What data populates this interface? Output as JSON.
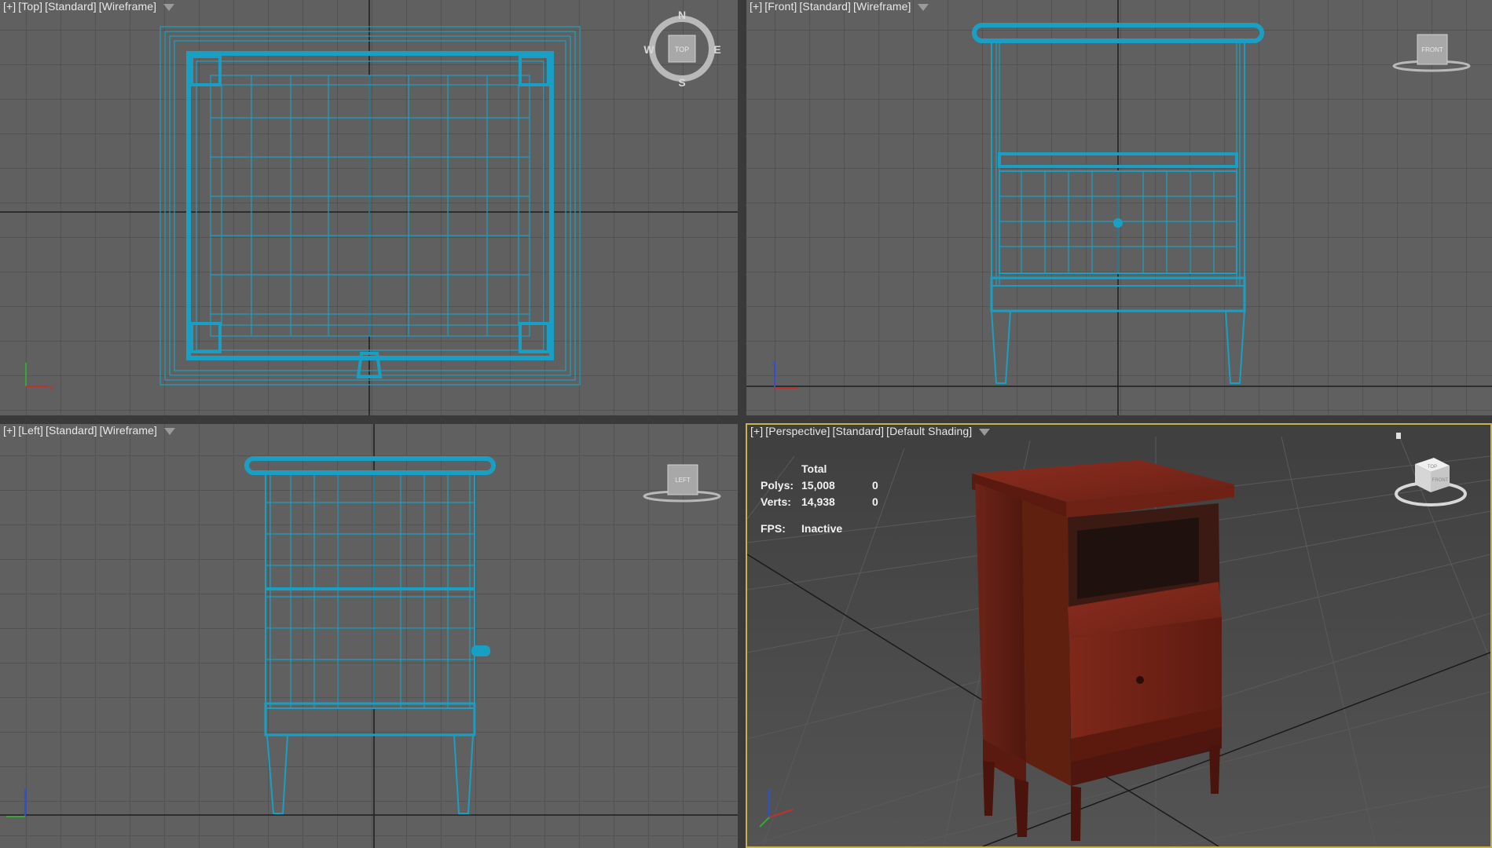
{
  "viewports": {
    "top": {
      "labels": [
        "[+]",
        "[Top]",
        "[Standard]",
        "[Wireframe]"
      ],
      "nav": {
        "cube_label": "TOP",
        "compass": {
          "n": "N",
          "s": "S",
          "e": "E",
          "w": "W"
        }
      }
    },
    "front": {
      "labels": [
        "[+]",
        "[Front]",
        "[Standard]",
        "[Wireframe]"
      ],
      "nav": {
        "cube_label": "FRONT"
      }
    },
    "left": {
      "labels": [
        "[+]",
        "[Left]",
        "[Standard]",
        "[Wireframe]"
      ],
      "nav": {
        "cube_label": "LEFT"
      }
    },
    "perspective": {
      "labels": [
        "[+]",
        "[Perspective]",
        "[Standard]",
        "[Default Shading]"
      ],
      "nav": {
        "cube_top": "TOP",
        "cube_front": "FRONT"
      },
      "stats": {
        "header": "Total",
        "polys_label": "Polys:",
        "polys_total": "15,008",
        "polys_selected": "0",
        "verts_label": "Verts:",
        "verts_total": "14,938",
        "verts_selected": "0",
        "fps_label": "FPS:",
        "fps_value": "Inactive"
      }
    }
  },
  "axes": {
    "x": "x",
    "y": "y",
    "z": "z"
  },
  "colors": {
    "wireframe": "#1a9fc4",
    "selection_border": "#c8b24a",
    "wood": "#7a2418",
    "grid_bg": "#606060"
  }
}
